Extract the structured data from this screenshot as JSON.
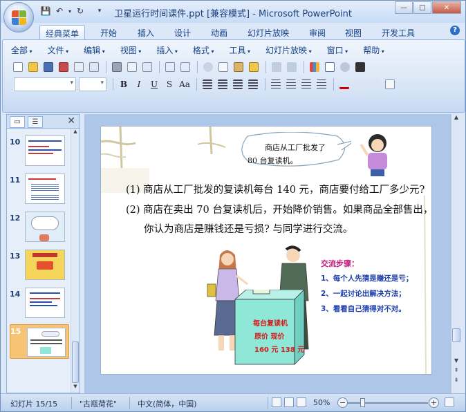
{
  "window": {
    "title": "卫星运行时间课件.ppt [兼容模式] - Microsoft PowerPoint",
    "controls": {
      "minimize": "—",
      "maximize": "□",
      "close": "✕"
    }
  },
  "quick_access": {
    "save": "💾",
    "undo": "↶",
    "undo_drop": "▾",
    "redo": "↻",
    "customize": "▾"
  },
  "ribbon_tabs": [
    "经典菜单",
    "开始",
    "插入",
    "设计",
    "动画",
    "幻灯片放映",
    "审阅",
    "视图",
    "开发工具"
  ],
  "help": "?",
  "menu": [
    "全部",
    "文件",
    "编辑",
    "视图",
    "插入",
    "格式",
    "工具",
    "幻灯片放映",
    "窗口",
    "帮助"
  ],
  "format_buttons": {
    "bold": "B",
    "italic": "I",
    "underline": "U",
    "strike": "S",
    "case": "Aa"
  },
  "left_pane": {
    "close": "✕",
    "slide_numbers": [
      "10",
      "11",
      "12",
      "13",
      "14",
      "15"
    ],
    "selected_slide": "15"
  },
  "slide": {
    "bubble_line1": "商店从工厂批发了",
    "bubble_line2": "80 台复读机。",
    "question1": "(1) 商店从工厂批发的复读机每台 140 元，商店要付给工厂多少元?",
    "question2_line1": "(2) 商店在卖出 70 台复读机后，开始降价销售。如果商品全部售出，",
    "question2_line2": "你认为商店是赚钱还是亏损? 与同学进行交流。",
    "steps_title": "交流步骤：",
    "steps": [
      "1、每个人先猜是赚还是亏；",
      "2、一起讨论出解决方法；",
      "3、看看自己猜得对不对。"
    ],
    "box_title": "每台复读机",
    "box_labels": "原价    现价",
    "box_prices": "160 元  138 元",
    "colors": {
      "steps_title": "#c1187a",
      "steps": "#1d3fae",
      "box": "#8fe7d8"
    }
  },
  "status_bar": {
    "slide_info": "幻灯片 15/15",
    "theme": "\"古瓶荷花\"",
    "language": "中文(简体，中国)",
    "zoom": "50%",
    "zoom_fraction": 0.18
  }
}
